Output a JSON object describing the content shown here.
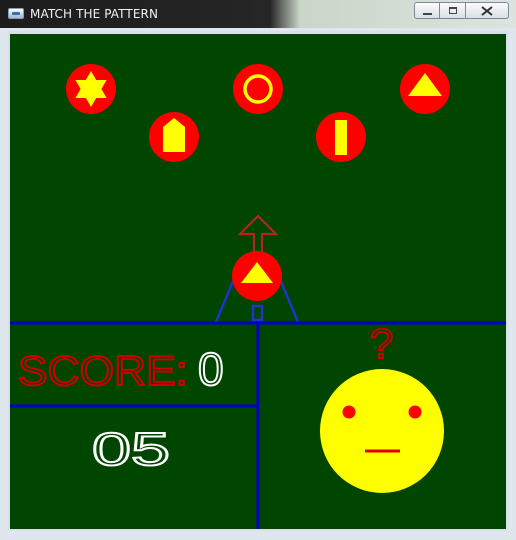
{
  "window": {
    "title": "MATCH THE PATTERN",
    "buttons": {
      "minimize": "minimize",
      "maximize": "maximize",
      "close": "close"
    }
  },
  "colors": {
    "board_background": "#004600",
    "token_red": "#ff0000",
    "shape_yellow": "#ffff00",
    "divider_blue": "#0000cc",
    "score_red": "#cc0000",
    "digits_white": "#ffffff",
    "face_yellow": "#ffff00",
    "question_red": "#cc0000"
  },
  "targets": [
    {
      "shape": "star-six-point",
      "icon": "star-icon"
    },
    {
      "shape": "house-pentagon",
      "icon": "house-icon"
    },
    {
      "shape": "ring",
      "icon": "ring-icon"
    },
    {
      "shape": "bar",
      "icon": "bar-icon"
    },
    {
      "shape": "triangle",
      "icon": "triangle-icon"
    }
  ],
  "launcher": {
    "loaded_shape": "triangle",
    "arrow_icon": "up-arrow-icon"
  },
  "score": {
    "label": "SCORE:",
    "value": "0"
  },
  "counter": {
    "value": "05"
  },
  "status_face": {
    "expression": "neutral",
    "question_mark": "?"
  }
}
